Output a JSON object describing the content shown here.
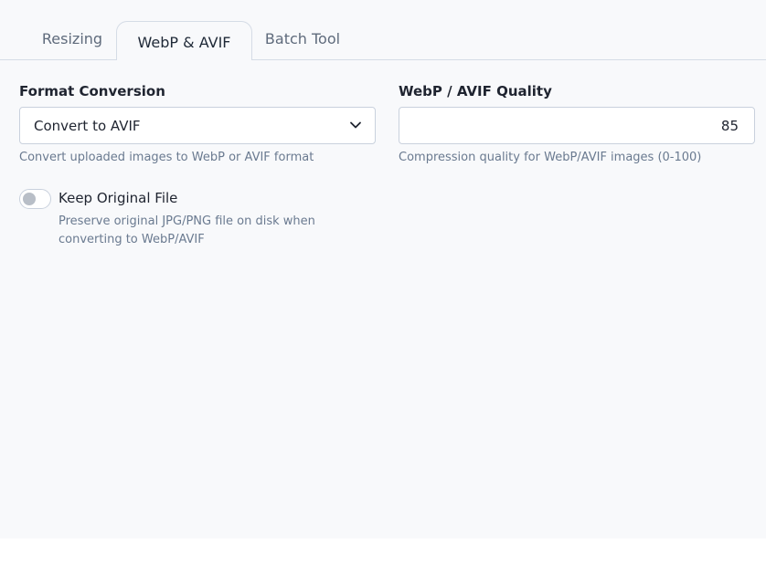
{
  "tabs": [
    {
      "label": "Resizing",
      "active": false
    },
    {
      "label": "WebP & AVIF",
      "active": true
    },
    {
      "label": "Batch Tool",
      "active": false
    }
  ],
  "format_conversion": {
    "label": "Format Conversion",
    "selected_value": "Convert to AVIF",
    "help": "Convert uploaded images to WebP or AVIF format"
  },
  "quality": {
    "label": "WebP / AVIF Quality",
    "value": "85",
    "help": "Compression quality for WebP/AVIF images (0-100)"
  },
  "keep_original": {
    "label": "Keep Original File",
    "enabled": false,
    "help": "Preserve original JPG/PNG file on disk when converting to WebP/AVIF"
  },
  "colors": {
    "panel_bg": "#f8f9fb",
    "text_primary": "#1f2430",
    "text_muted": "#6a7a90",
    "border": "#c9d1dd"
  },
  "icons": {
    "select": "chevron-down-icon",
    "toggle": "toggle-switch"
  }
}
